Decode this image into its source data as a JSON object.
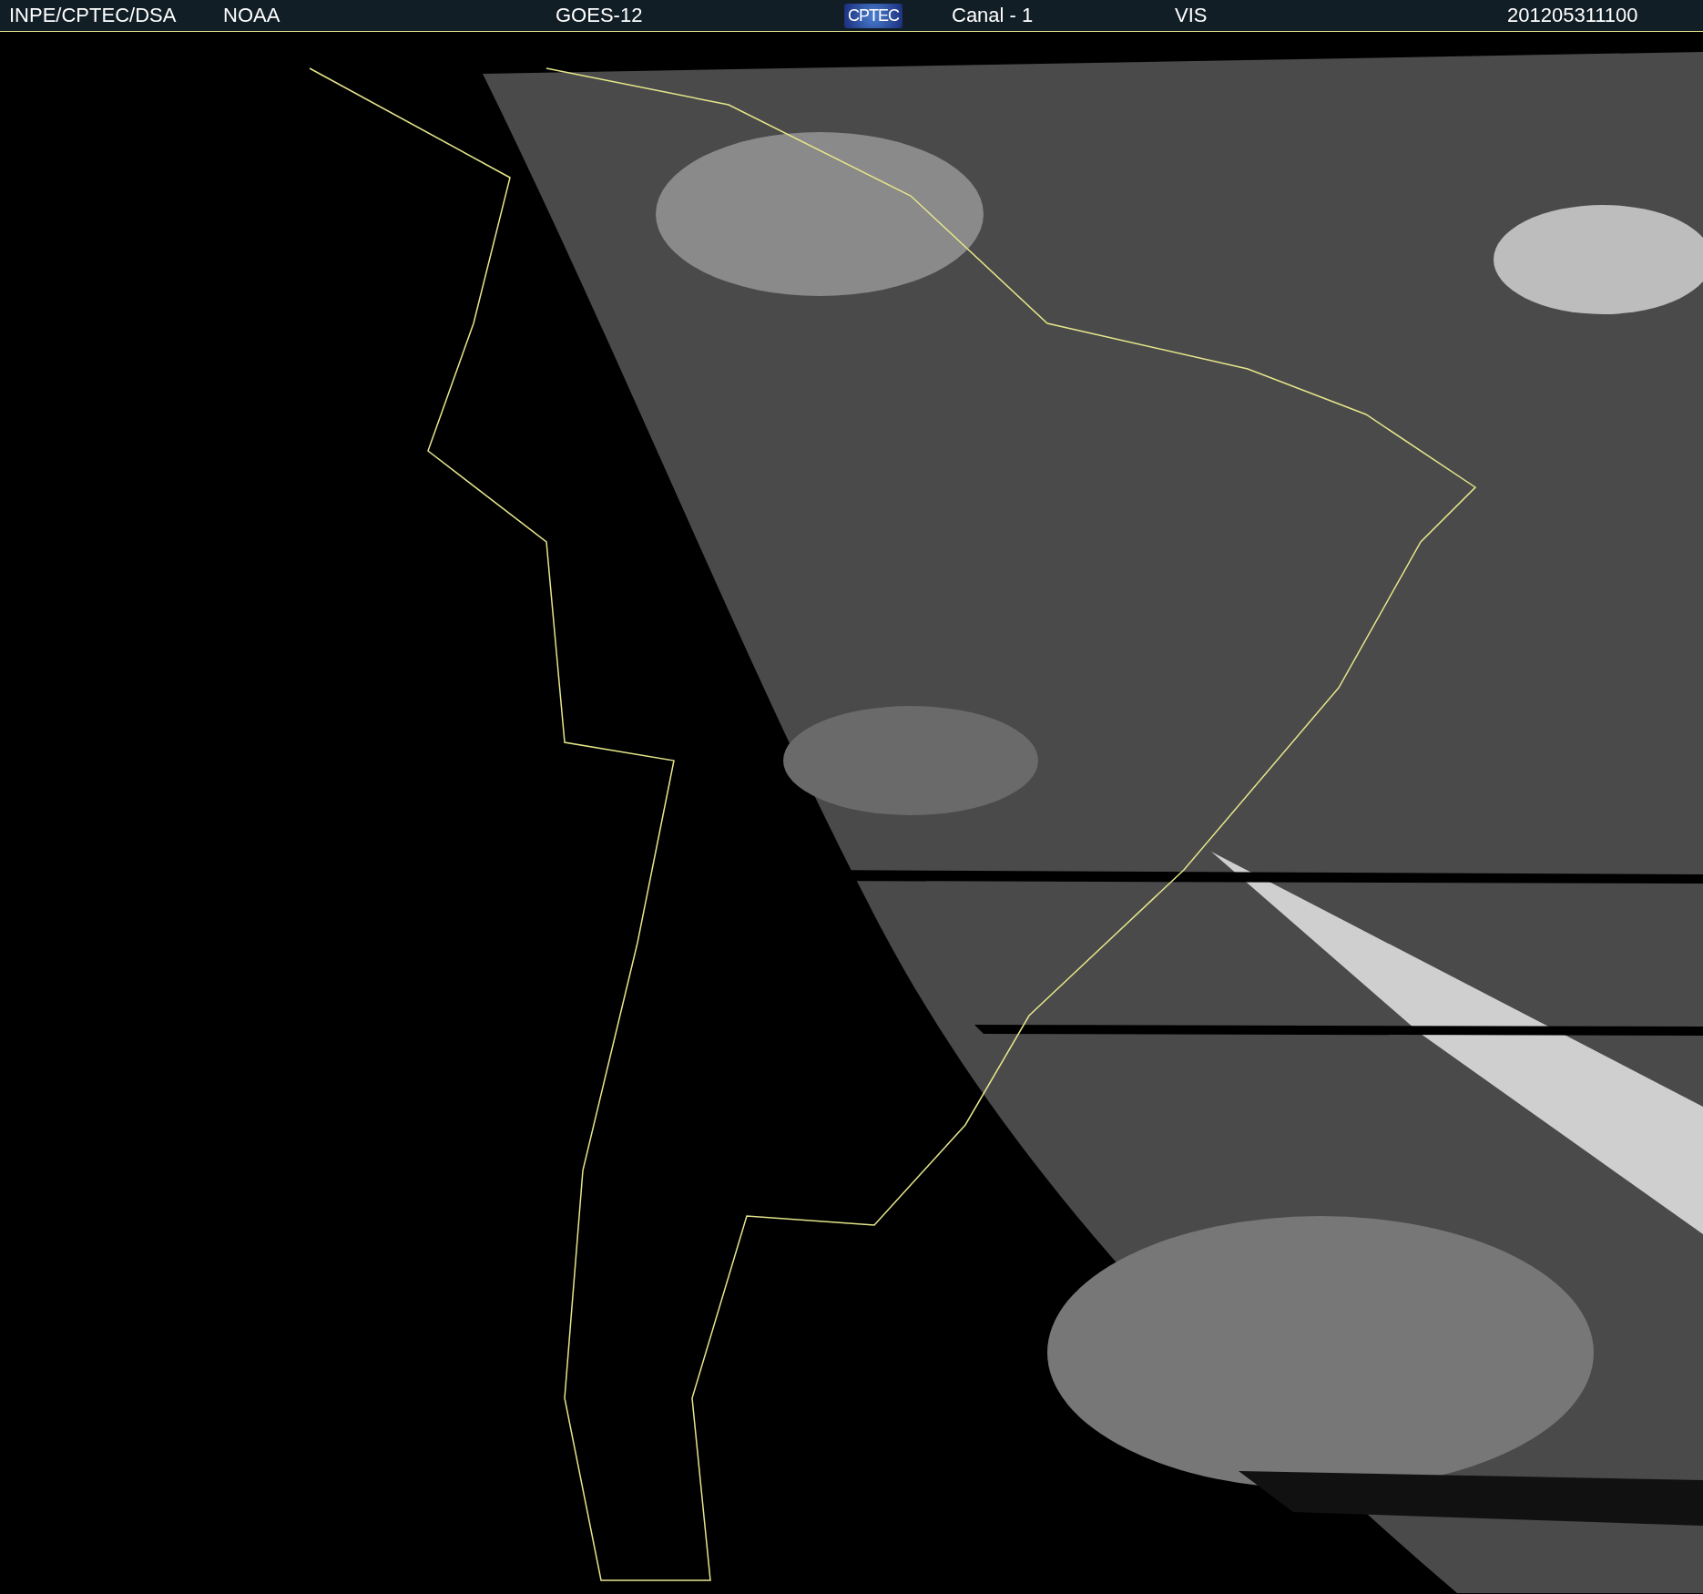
{
  "header": {
    "items": [
      {
        "kind": "text",
        "label": "INPE/CPTEC/DSA"
      },
      {
        "kind": "text",
        "label": "NOAA"
      },
      {
        "kind": "text",
        "label": "GOES-12"
      },
      {
        "kind": "logo",
        "label": "CPTEC"
      },
      {
        "kind": "text",
        "label": "Canal - 1"
      },
      {
        "kind": "text",
        "label": "VIS"
      },
      {
        "kind": "text",
        "label": "201205311100"
      }
    ]
  }
}
